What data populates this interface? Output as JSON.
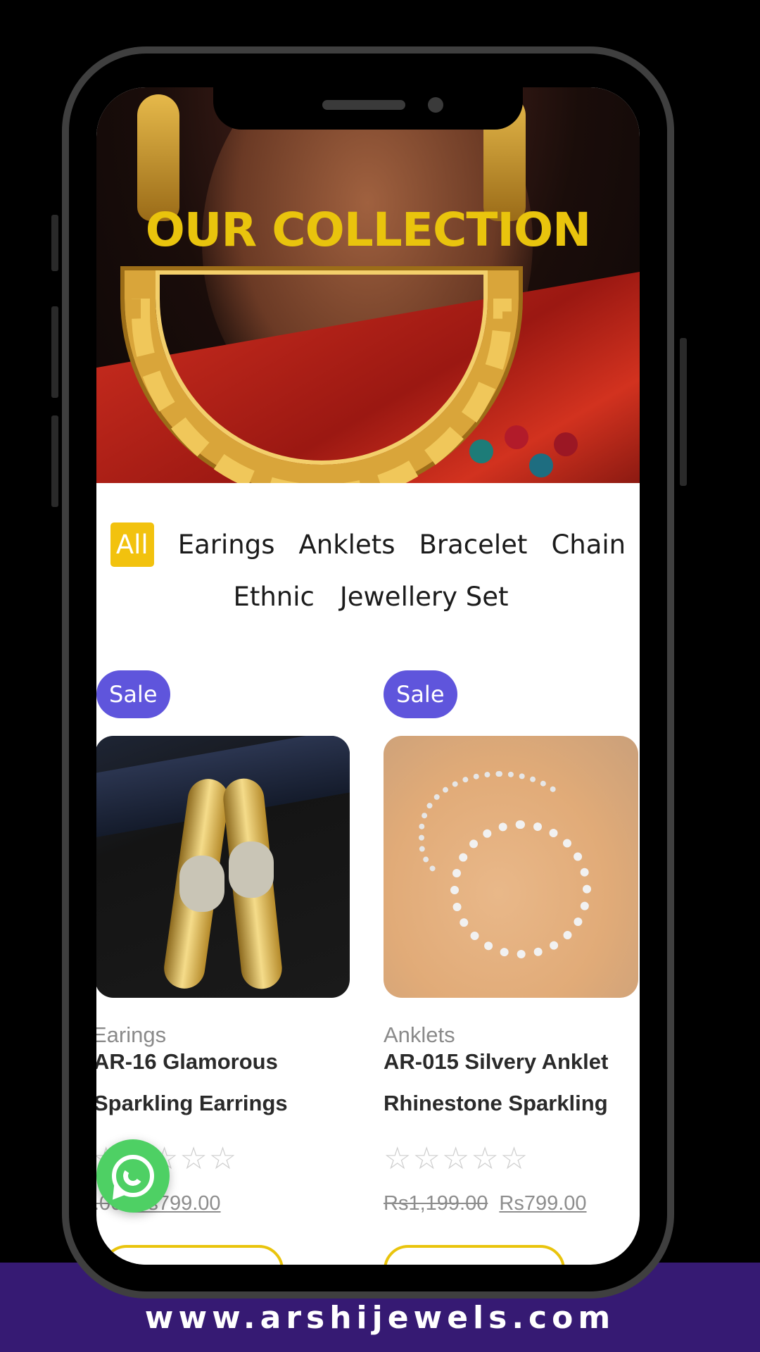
{
  "hero": {
    "title": "OUR COLLECTION"
  },
  "categories": {
    "items": [
      {
        "label": "All",
        "active": true
      },
      {
        "label": "Earings"
      },
      {
        "label": "Anklets"
      },
      {
        "label": "Bracelet"
      },
      {
        "label": "Chain"
      },
      {
        "label": "Ethnic"
      },
      {
        "label": "Jewellery Set"
      }
    ]
  },
  "products": [
    {
      "badge": "Sale",
      "category": "Earings",
      "name_line1": "AR-16 Glamorous",
      "name_line2": "Sparkling Earrings",
      "rating_stars": "☆☆☆☆☆",
      "rating": 0,
      "price_old": ".00",
      "price_new": "Rs799.00"
    },
    {
      "badge": "Sale",
      "category": "Anklets",
      "name_line1": "AR-015 Silvery Anklet",
      "name_line2": "Rhinestone Sparkling",
      "rating_stars": "☆☆☆☆☆",
      "rating": 0,
      "price_old": "Rs1,199.00",
      "price_new": "Rs799.00"
    }
  ],
  "footer": {
    "url": "www.arshijewels.com"
  },
  "icons": {
    "chat": "whatsapp-icon"
  },
  "colors": {
    "accent_yellow": "#e9c40d",
    "sale_badge": "#5f55dc",
    "footer_band": "#361a73",
    "whatsapp_green": "#4ed064"
  }
}
